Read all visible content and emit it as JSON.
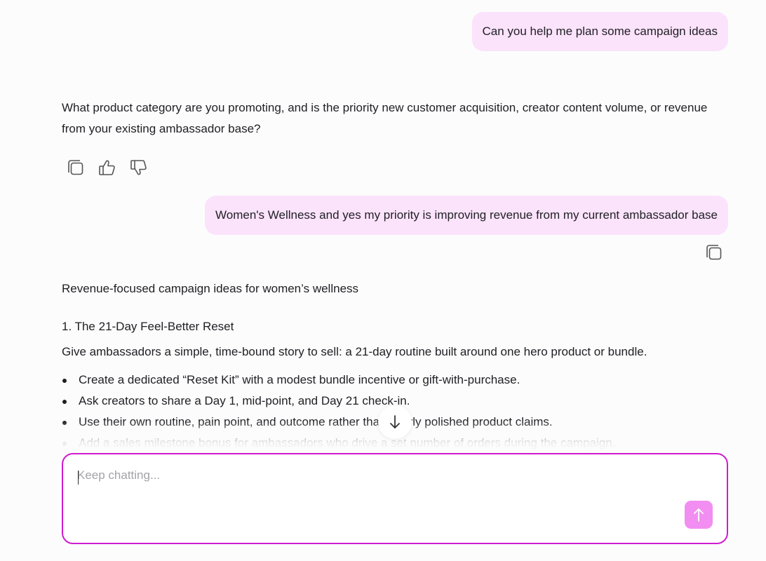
{
  "conversation": {
    "user_message_1": "Can you help me plan some campaign ideas",
    "assistant_reply_1": "What product category are you promoting, and is the priority new customer acquisition, creator content volume, or revenue from your existing ambassador base?",
    "user_message_2": "Women's Wellness and yes my priority is improving revenue from my current ambassador base",
    "response": {
      "heading": "Revenue-focused campaign ideas for women’s wellness",
      "section_1_title": "1. The 21-Day Feel-Better Reset",
      "section_1_intro": "Give ambassadors a simple, time-bound story to sell: a 21-day routine built around one hero product or bundle.",
      "bullets": [
        "Create a dedicated “Reset Kit” with a modest bundle incentive or gift-with-purchase.",
        "Ask creators to share a Day 1, mid-point, and Day 21 check-in.",
        "Use their own routine, pain point, and outcome rather than overly polished product claims.",
        "Add a sales milestone bonus for ambassadors who drive a set number of orders during the campaign."
      ]
    }
  },
  "composer": {
    "placeholder": "Keep chatting..."
  },
  "icons": {
    "copy": "copy-icon",
    "thumbs_up": "thumbs-up-icon",
    "thumbs_down": "thumbs-down-icon",
    "scroll_down": "arrow-down-icon",
    "send": "arrow-up-icon"
  },
  "colors": {
    "user_bubble": "#fbe3fb",
    "composer_border": "#d01bd0",
    "send_button": "#f28ef2",
    "icon_stroke": "#555555"
  }
}
